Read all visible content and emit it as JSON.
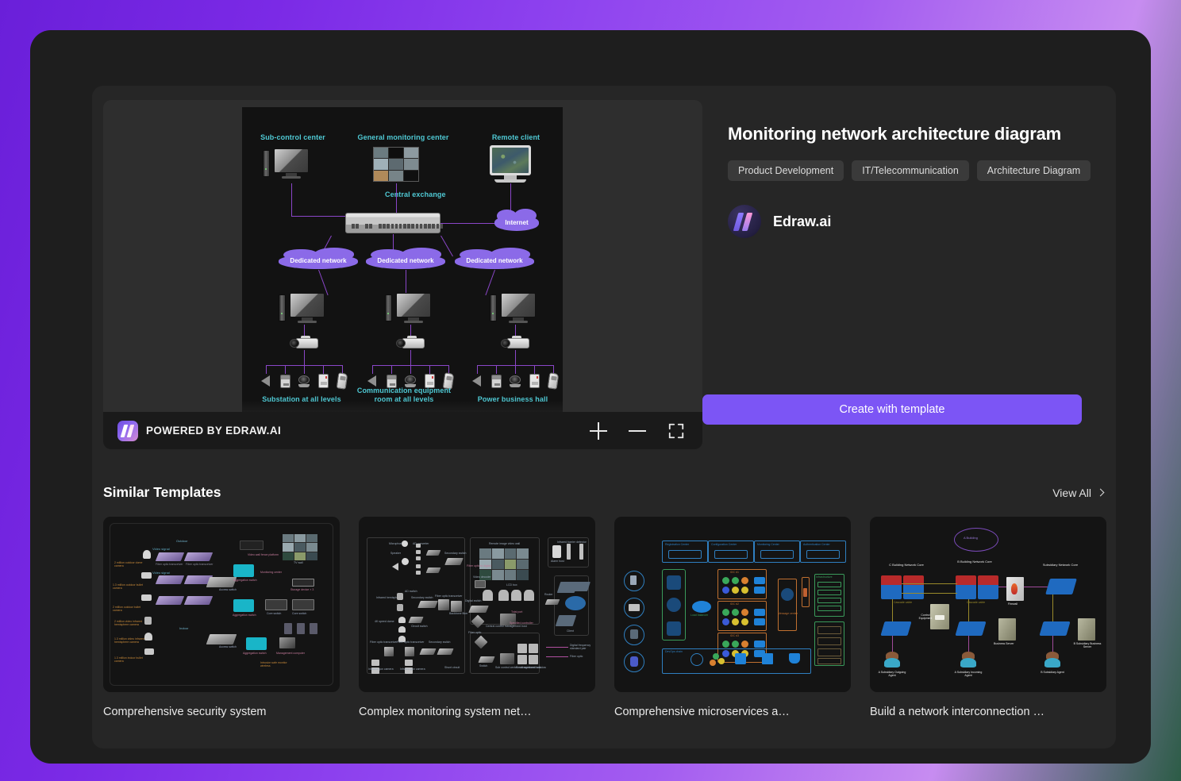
{
  "template": {
    "title": "Monitoring network architecture diagram",
    "tags": [
      "Product Development",
      "IT/Telecommunication",
      "Architecture Diagram"
    ],
    "author": "Edraw.ai",
    "create_button": "Create with template"
  },
  "preview": {
    "watermark": "POWERED BY EDRAW.AI",
    "zoom_in_icon": "plus-icon",
    "zoom_out_icon": "minus-icon",
    "fullscreen_icon": "fullscreen-icon"
  },
  "diagram": {
    "labels": {
      "sub_control": "Sub-control center",
      "general_monitoring": "General monitoring center",
      "remote_client": "Remote client",
      "central_exchange": "Central exchange",
      "internet": "Internet",
      "dedicated_network_1": "Dedicated network",
      "dedicated_network_2": "Dedicated network",
      "dedicated_network_3": "Dedicated network",
      "substation": "Substation at all levels",
      "comm_room": "Communication equipment room at all levels",
      "power_hall": "Power business hall"
    },
    "colors": {
      "label": "#4fc9d4",
      "cloud": "#8b6ae8",
      "wire": "#8a46c8"
    }
  },
  "similar": {
    "heading": "Similar Templates",
    "view_all": "View All",
    "cards": [
      {
        "title": "Comprehensive security system"
      },
      {
        "title": "Complex monitoring system net…"
      },
      {
        "title": "Comprehensive microservices a…"
      },
      {
        "title": "Build a network interconnection …"
      }
    ]
  }
}
